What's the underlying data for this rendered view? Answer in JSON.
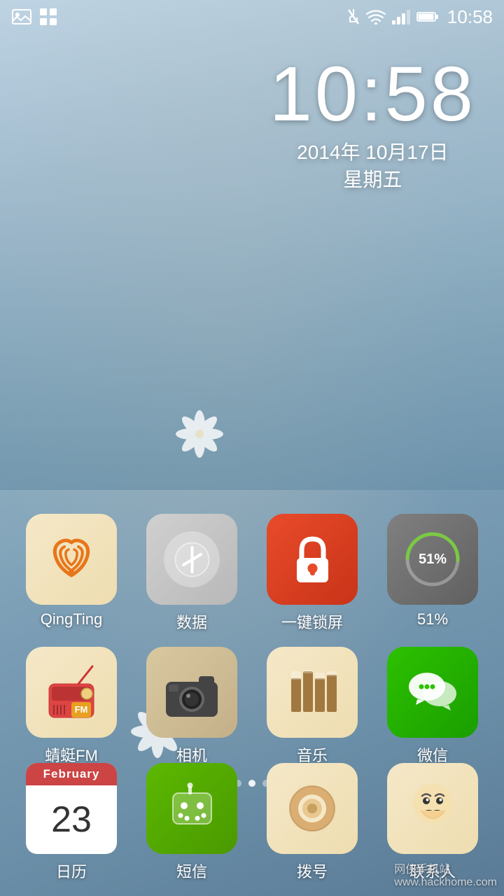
{
  "statusBar": {
    "leftIcons": [
      "gallery-icon",
      "grid-icon"
    ],
    "time": "10:58",
    "rightIcons": [
      "signal-off-icon",
      "wifi-icon",
      "signal-bars-icon",
      "battery-icon"
    ]
  },
  "clock": {
    "time": "10:58",
    "date": "2014年 10月17日",
    "weekday": "星期五"
  },
  "dots": [
    {
      "active": false
    },
    {
      "active": false
    },
    {
      "active": true
    },
    {
      "active": false
    },
    {
      "active": false
    }
  ],
  "appRows": [
    {
      "apps": [
        {
          "id": "qingting",
          "label": "QingTing",
          "icon": "wifi-radio"
        },
        {
          "id": "data",
          "label": "数据",
          "icon": "data-toggle"
        },
        {
          "id": "lockscreen",
          "label": "一键锁屏",
          "icon": "lock"
        },
        {
          "id": "battery",
          "label": "51%",
          "icon": "battery-51"
        }
      ]
    },
    {
      "apps": [
        {
          "id": "dragonflyfm",
          "label": "蜻蜓FM",
          "icon": "fm-radio"
        },
        {
          "id": "camera",
          "label": "相机",
          "icon": "camera"
        },
        {
          "id": "music",
          "label": "音乐",
          "icon": "music"
        },
        {
          "id": "wechat",
          "label": "微信",
          "icon": "wechat"
        }
      ]
    }
  ],
  "dockApps": [
    {
      "id": "calendar",
      "label": "日历",
      "icon": "calendar",
      "month": "February",
      "day": "23"
    },
    {
      "id": "sms",
      "label": "短信",
      "icon": "sms"
    },
    {
      "id": "dialer",
      "label": "拨号",
      "icon": "dialer"
    },
    {
      "id": "contacts",
      "label": "联系人",
      "icon": "contacts"
    }
  ],
  "watermark": "网侠手机站\nwww.hackhome.com"
}
